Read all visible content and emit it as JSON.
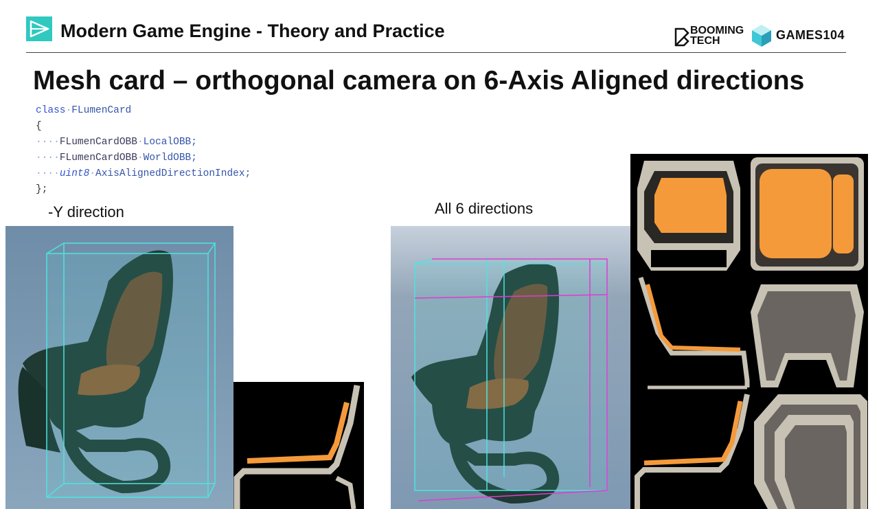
{
  "header": {
    "course_title": "Modern Game Engine - Theory and Practice",
    "booming_line1": "BOOMING",
    "booming_line2": "TECH",
    "games_logo": "GAMES104"
  },
  "slide": {
    "title": "Mesh card – orthogonal camera on 6-Axis Aligned directions"
  },
  "code": {
    "line1_kw": "class",
    "line1_name": "FLumenCard",
    "open_brace": "{",
    "line3_type": "FLumenCardOBB",
    "line3_var": "LocalOBB;",
    "line4_type": "FLumenCardOBB",
    "line4_var": "WorldOBB;",
    "line5_type": "uint8",
    "line5_var": "AxisAlignedDirectionIndex;",
    "close_brace": "};"
  },
  "captions": {
    "minus_y": "-Y direction",
    "all_six": "All 6  directions"
  },
  "colors": {
    "obb_cyan": "#4fe3e0",
    "obb_magenta": "#e03ad0",
    "card_orange": "#f59a3a",
    "card_frame": "#c8c2b4",
    "chair_green": "#1f3a33",
    "chair_leather": "#6b4a2e"
  }
}
